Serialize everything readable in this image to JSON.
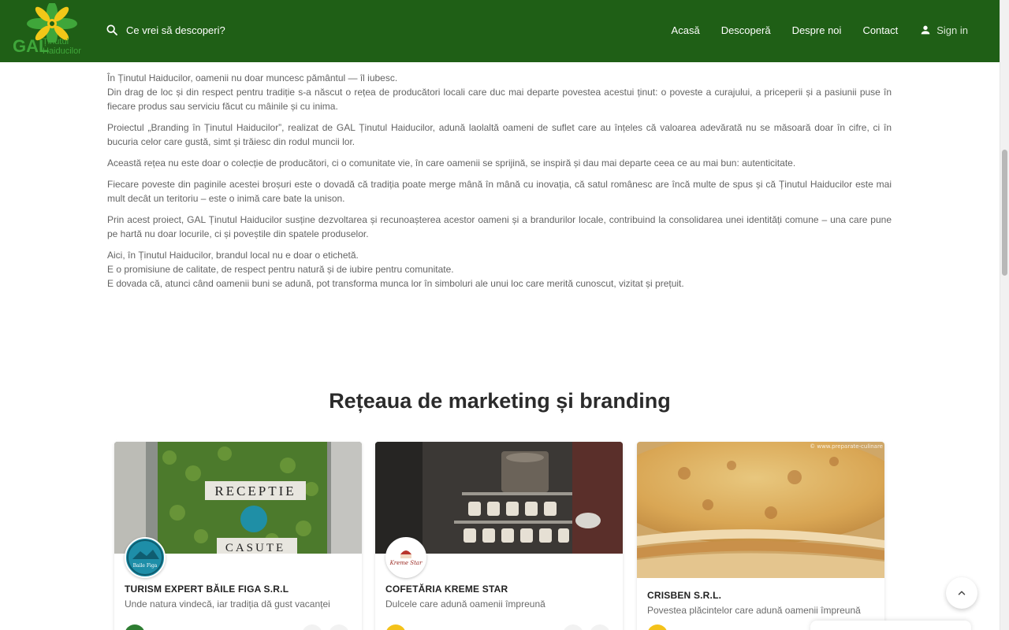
{
  "header": {
    "logo_text": "GAL",
    "logo_sub1": "Ținutul",
    "logo_sub2": "Haiducilor",
    "search_placeholder": "Ce vrei să descoperi?",
    "nav": [
      "Acasă",
      "Descoperă",
      "Despre noi",
      "Contact"
    ],
    "signin_label": "Sign in"
  },
  "intro": {
    "paragraphs": [
      "În Ținutul Haiducilor, oamenii nu doar muncesc pământul — îl iubesc.\nDin drag de loc și din respect pentru tradiție s-a născut o rețea de producători locali care duc mai departe povestea acestui ținut: o poveste a curajului, a priceperii și a pasiunii puse în fiecare produs sau serviciu făcut cu mâinile și cu inima.",
      "Proiectul „Branding în Ținutul Haiducilor”, realizat de GAL Ținutul Haiducilor, adună laolaltă oameni de suflet care au înțeles că valoarea adevărată nu se măsoară doar în cifre, ci în bucuria celor care gustă, simt și trăiesc din rodul muncii lor.",
      "Această rețea nu este doar o colecție de producători, ci o comunitate vie, în care oamenii se sprijină, se inspiră și dau mai departe ceea ce au mai bun: autenticitate.",
      "Fiecare poveste din paginile acestei broșuri este o dovadă că tradiția poate merge mână în mână cu inovația, că satul românesc are încă multe de spus și că Ținutul Haiducilor este mai mult decât un teritoriu – este o inimă care bate la unison.",
      "Prin acest proiect, GAL Ținutul Haiducilor susține dezvoltarea și recunoașterea acestor oameni și a brandurilor locale, contribuind la consolidarea unei identități comune – una care pune pe hartă nu doar locurile, ci și poveștile din spatele produselor.",
      "Aici, în Ținutul Haiducilor, brandul local nu e doar o etichetă.\nE o promisiune de calitate, de respect pentru natură și de iubire pentru comunitate.\nE dovada că, atunci când oamenii buni se adună, pot transforma munca lor în simboluri ale unui loc care merită cunoscut, vizitat și prețuit."
    ]
  },
  "section": {
    "title": "Rețeaua de marketing și branding"
  },
  "cards": [
    {
      "title": "TURISM EXPERT BĂILE FIGA S.R.L",
      "subtitle": "Unde natura vindecă, iar tradiția dă gust vacanței",
      "image_sign_top": "RECEPTIE",
      "image_sign_bottom": "CASUTE",
      "logo_text": "Baile Figa",
      "dot_color": "#2e7d32"
    },
    {
      "title": "COFETĂRIA KREME STAR",
      "subtitle": "Dulcele care adună oamenii împreună",
      "logo_text": "Kreme Star",
      "dot_color": "#f4c21a"
    },
    {
      "title": "CRISBEN S.R.L.",
      "subtitle": "Povestea plăcintelor care adună oamenii împreună",
      "watermark": "© www.preparate-culinare",
      "dot_color": "#f4c21a"
    }
  ],
  "colors": {
    "header_bg": "#1f5f16",
    "logo_green": "#3fa63a",
    "logo_yellow": "#f2c718"
  }
}
